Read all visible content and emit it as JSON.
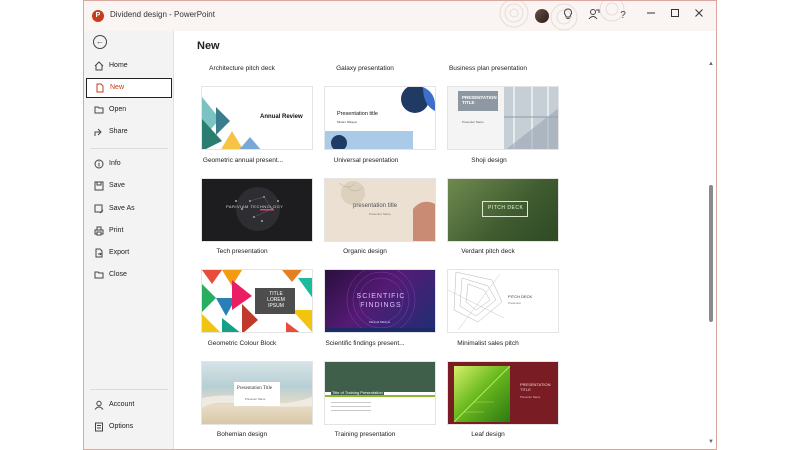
{
  "titlebar": {
    "app_icon_letter": "P",
    "title": "Dividend design  -  PowerPoint",
    "icons": [
      "lightbulb-icon",
      "feedback-icon",
      "help-icon"
    ],
    "controls": [
      "minimize-icon",
      "maximize-icon",
      "close-icon"
    ]
  },
  "sidebar": {
    "back_label": "←",
    "items": [
      {
        "label": "Home",
        "icon": "home-icon"
      },
      {
        "label": "New",
        "icon": "new-file-icon",
        "active": true
      },
      {
        "label": "Open",
        "icon": "folder-open-icon"
      },
      {
        "label": "Share",
        "icon": "share-icon"
      },
      {
        "label": "Info",
        "icon": "info-icon"
      },
      {
        "label": "Save",
        "icon": "save-icon"
      },
      {
        "label": "Save As",
        "icon": "save-as-icon"
      },
      {
        "label": "Print",
        "icon": "print-icon"
      },
      {
        "label": "Export",
        "icon": "export-icon"
      },
      {
        "label": "Close",
        "icon": "close-file-icon"
      }
    ],
    "bottom_items": [
      {
        "label": "Account",
        "icon": "account-icon"
      },
      {
        "label": "Options",
        "icon": "options-icon"
      }
    ]
  },
  "main": {
    "title": "New",
    "top_captions": [
      "Architecture pitch deck",
      "Galaxy presentation",
      "Business plan presentation"
    ],
    "templates": [
      {
        "name": "Geometric annual present...",
        "thumb_text": "Annual Review"
      },
      {
        "name": "Universal presentation",
        "thumb_text": "Presentation title",
        "thumb_sub": "Miriam Mikayel"
      },
      {
        "name": "Shoji design",
        "thumb_text": "PRESENTATION TITLE",
        "thumb_sub": "Presenter Name"
      },
      {
        "name": "Tech presentation",
        "thumb_text": "PARIVIAM TECHNOLOGY"
      },
      {
        "name": "Organic design",
        "thumb_text": "presentation title",
        "thumb_sub": "Presenter Name"
      },
      {
        "name": "Verdant pitch deck",
        "thumb_text": "PITCH DECK"
      },
      {
        "name": "Geometric Colour Block",
        "thumb_text": "TITLE LOREM IPSUM"
      },
      {
        "name": "Scientific findings present...",
        "thumb_text": "SCIENTIFIC FINDINGS",
        "thumb_sub": "Mikayel Mikayel"
      },
      {
        "name": "Minimalist sales pitch",
        "thumb_text": "PITCH DECK",
        "thumb_sub": "Presenter"
      },
      {
        "name": "Bohemian design",
        "thumb_text": "Presentation Title",
        "thumb_sub": "Presenter Name"
      },
      {
        "name": "Training presentation",
        "thumb_text": "Title of Training Presentation"
      },
      {
        "name": "Leaf design",
        "thumb_text": "PRESENTATION TITLE",
        "thumb_sub": "Presenter Name"
      }
    ]
  },
  "scrollbar": {
    "up": "▲",
    "down": "▼"
  },
  "colors": {
    "accent": "#c43e1c",
    "sidebar_bg": "#f3f3f3"
  }
}
